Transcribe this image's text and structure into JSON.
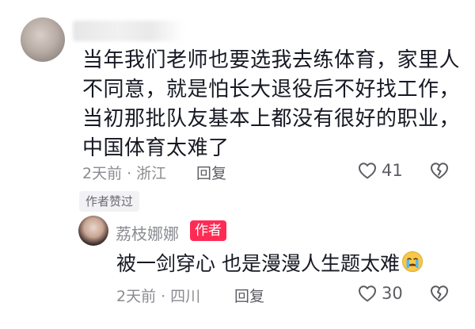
{
  "comment": {
    "lines": [
      "当年我们老师也要选我去练体育，家里人",
      "不同意，就是怕长大退役后不好找工作，",
      "当初那批队友基本上都没有很好的职业，",
      "中国体育太难了"
    ],
    "time": "2天前",
    "separator": "·",
    "location": "浙江",
    "reply_label": "回复",
    "like_count": "41",
    "author_liked_badge": "作者赞过"
  },
  "reply": {
    "username": "荔枝娜娜",
    "author_badge": "作者",
    "text": "被一剑穿心  也是漫漫人生题太难",
    "emoji": "crying-face-icon",
    "time": "2天前",
    "separator": "·",
    "location": "四川",
    "reply_label": "回复",
    "like_count": "30"
  },
  "colors": {
    "text_primary": "#161823",
    "text_secondary": "#8a8b91",
    "author_badge_bg": "#fe2c55"
  }
}
